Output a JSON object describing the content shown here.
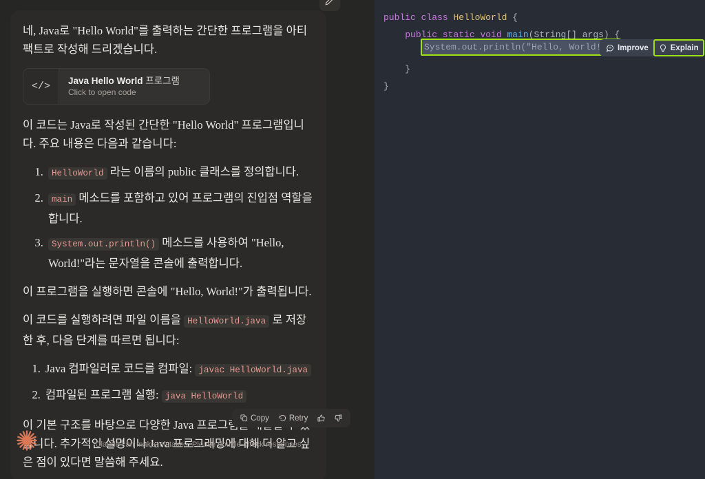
{
  "left_panel": {
    "edit_icon": "pencil-edit-icon",
    "message": {
      "paragraph_1": "네, Java로 \"Hello World\"를 출력하는 간단한 프로그램을 아티팩트로 작성해 드리겠습니다.",
      "artifact": {
        "icon": "code-brackets-icon",
        "title_bold": "Java Hello World",
        "title_rest": " 프로그램",
        "subtitle": "Click to open code"
      },
      "paragraph_2": "이 코드는 Java로 작성된 간단한 \"Hello World\" 프로그램입니다. 주요 내용은 다음과 같습니다:",
      "list_1": [
        {
          "code": "HelloWorld",
          "text_after": " 라는 이름의 public 클래스를 정의합니다."
        },
        {
          "code": "main",
          "text_after": " 메소드를 포함하고 있어 프로그램의 진입점 역할을 합니다."
        },
        {
          "code": "System.out.println()",
          "text_after": " 메소드를 사용하여 \"Hello, World!\"라는 문자열을 콘솔에 출력합니다."
        }
      ],
      "paragraph_3": "이 프로그램을 실행하면 콘솔에 \"Hello, World!\"가 출력됩니다.",
      "paragraph_4_pre": "이 코드를 실행하려면 파일 이름을 ",
      "paragraph_4_code": "HelloWorld.java",
      "paragraph_4_post": " 로 저장한 후, 다음 단계를 따르면 됩니다:",
      "list_2": [
        {
          "text_before": "Java 컴파일러로 코드를 컴파일: ",
          "code": "javac HelloWorld.java"
        },
        {
          "text_before": "컴파일된 프로그램 실행: ",
          "code": "java HelloWorld"
        }
      ],
      "paragraph_5": "이 기본 구조를 바탕으로 다양한 Java 프로그램을 개발할 수 있습니다. 추가적인 설명이나 Java 프로그래밍에 대해 더 알고 싶은 점이 있다면 말씀해 주세요."
    },
    "action_bar": {
      "copy_label": "Copy",
      "copy_icon": "copy-icon",
      "retry_label": "Retry",
      "retry_icon": "refresh-retry-icon",
      "thumbs_up_icon": "thumbs-up-icon",
      "thumbs_down_icon": "thumbs-down-icon"
    },
    "footer": {
      "logo_icon": "claude-starburst-logo",
      "disclaimer": "Claude can make mistakes. Please double-check responses."
    }
  },
  "code_panel": {
    "language": "java",
    "lines": {
      "l1_kw1": "public",
      "l1_kw2": "class",
      "l1_cls": "HelloWorld",
      "l1_brace": "{",
      "l2_kw1": "public",
      "l2_kw2": "static",
      "l2_kw3": "void",
      "l2_fn": "main",
      "l2_params": "(String[] args) {",
      "l3_selected": "System.out.println(\"Hello, World!\");",
      "l4_brace": "}",
      "l5_brace": "}"
    },
    "actions": [
      {
        "label": "Improve",
        "icon": "message-square-icon",
        "highlighted": false
      },
      {
        "label": "Explain",
        "icon": "lightbulb-icon",
        "highlighted": true
      }
    ]
  },
  "colors": {
    "chat_background": "#262624",
    "bubble_background": "#2b2a28",
    "code_background": "#282c34",
    "highlight_green": "#9fe316",
    "selection_gray": "#4b5263",
    "inline_code_text": "#e79a94",
    "claude_orange": "#d97757",
    "keyword_purple": "#c678dd",
    "class_yellow": "#e5c07b",
    "function_blue": "#61afef",
    "string_green": "#98c379"
  }
}
